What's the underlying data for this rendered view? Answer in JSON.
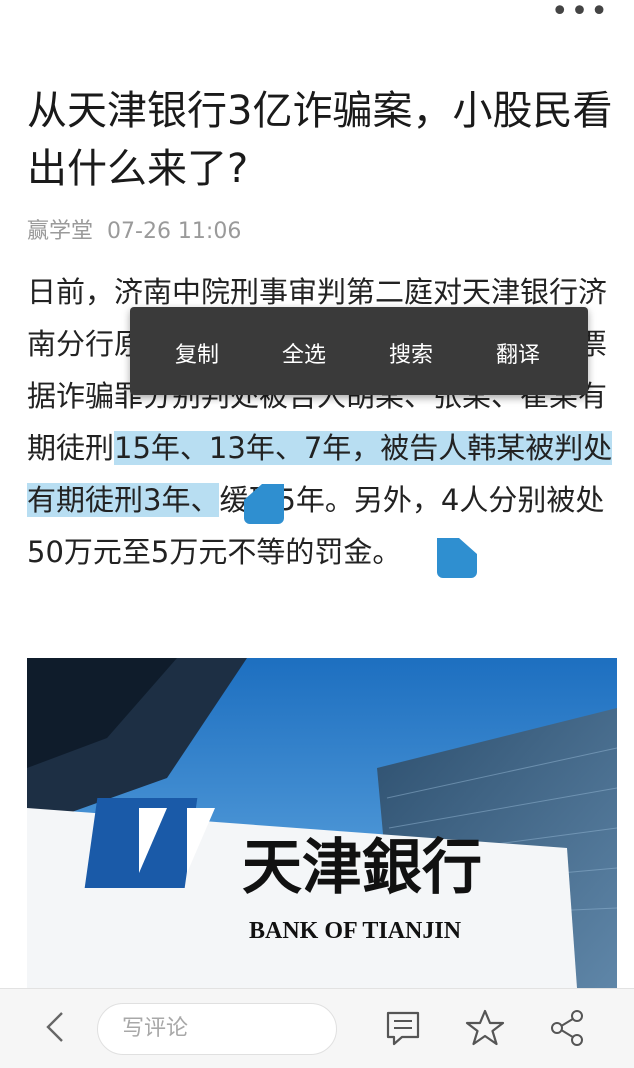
{
  "article": {
    "title": "从天津银行3亿诈骗案，小股民看出什么来了?",
    "source": "赢学堂",
    "time": "07-26 11:06",
    "body_before": "日前，济南中院刑事审判第二庭对天津银行济南分行原行长陈某和某银行营业部等法院以票据诈骗罪分别判处被告人胡某、张某、崔某有期徒刑",
    "body_selected": "15年、13年、7年，被告人韩某被判处有期徒刑3年、",
    "body_after": "缓刑5年。另外，4人分别被处50万元至5万元不等的罚金。"
  },
  "toolbar": {
    "more_label": "•••"
  },
  "selection_menu": {
    "copy_label": "复制",
    "select_all_label": "全选",
    "search_label": "搜索",
    "translate_label": "翻译"
  },
  "hero_image": {
    "brand_cn": "天津銀行",
    "brand_en": "BANK OF TIANJIN",
    "logo_color": "#1a5aa8"
  },
  "bottom_bar": {
    "comment_placeholder": "写评论"
  },
  "colors": {
    "selection_highlight": "#b8def2",
    "menu_background": "#3a3a3a",
    "handle": "#2f8fd0"
  }
}
